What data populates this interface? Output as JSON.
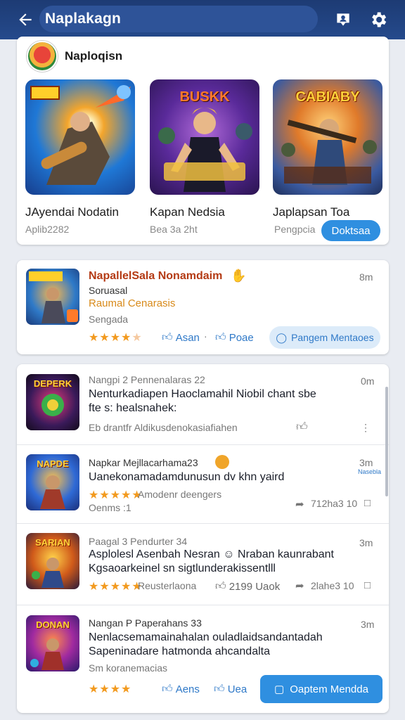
{
  "header": {
    "title": "Naplakagn",
    "back_icon": "arrow-left-icon",
    "profile_icon": "person-badge-icon",
    "settings_icon": "gear-icon",
    "bg_color": "#1d3b74"
  },
  "featured": {
    "name": "Naploqisn",
    "tiles": [
      {
        "art_title": "",
        "label": "JAyendai Nodatin",
        "sub": "Aplib2282"
      },
      {
        "art_title": "BUSKK",
        "label": "Kapan Nedsia",
        "sub": "Bea 3a 2ht"
      },
      {
        "art_title": "CABIABY",
        "label": "Japlapsan Toa",
        "sub": "Pengpcia"
      }
    ],
    "button": "Doktsaa"
  },
  "promo": {
    "title": "NapallelSala Nonamdaim",
    "sub1": "Soruasal",
    "sub2": "Raumal Cenarasis",
    "sub3": "Sengada",
    "time": "8m",
    "rating": 4,
    "action1": "Asan",
    "action2": "Poae",
    "button": "Pangem Mentaoes"
  },
  "feed": [
    {
      "art_title": "DEPERK",
      "meta": "Nangpi 2 Pennenalaras 22",
      "time": "0m",
      "line1": "Nenturkadiapen Haoclamahil Niobil chant sbe",
      "line2": "fte s: healsnahek:",
      "footer": "Eb drantfr Aldikusdenokasiafiahen"
    },
    {
      "art_title": "NAPDE",
      "meta": "Napkar Mejllacarhama23",
      "time": "3m",
      "tag": "Nasebla",
      "line1": "Uanekonamadamdunusun dv khn yaird",
      "rating_text": "Amodenr deengers",
      "line2": "Oenms :1",
      "count": "712ha3 10"
    },
    {
      "art_title": "SARIAN",
      "meta": "Paagal 3 Pendurter 34",
      "time": "3m",
      "line1": "Asplolesl Asenbah Nesran ☺ Nraban kaunrabant",
      "line2": "Kgsaoarkeinel sn sigtlunderakissentlll",
      "rating_text": "Reusterlaona",
      "action": "2199 Uaok",
      "count": "2lahe3 10"
    },
    {
      "art_title": "DONAN",
      "meta": "Nangan P Paperahans 33",
      "time": "3m",
      "line1": "Nenlacsemamainahalan ouladlaidsandantadah",
      "line2": "Sapeninadare hatmonda ahcandalta",
      "line3": "Sm koranemacias",
      "action1": "Aens",
      "action2": "Uea",
      "button": "Oaptem Mendda"
    }
  ]
}
